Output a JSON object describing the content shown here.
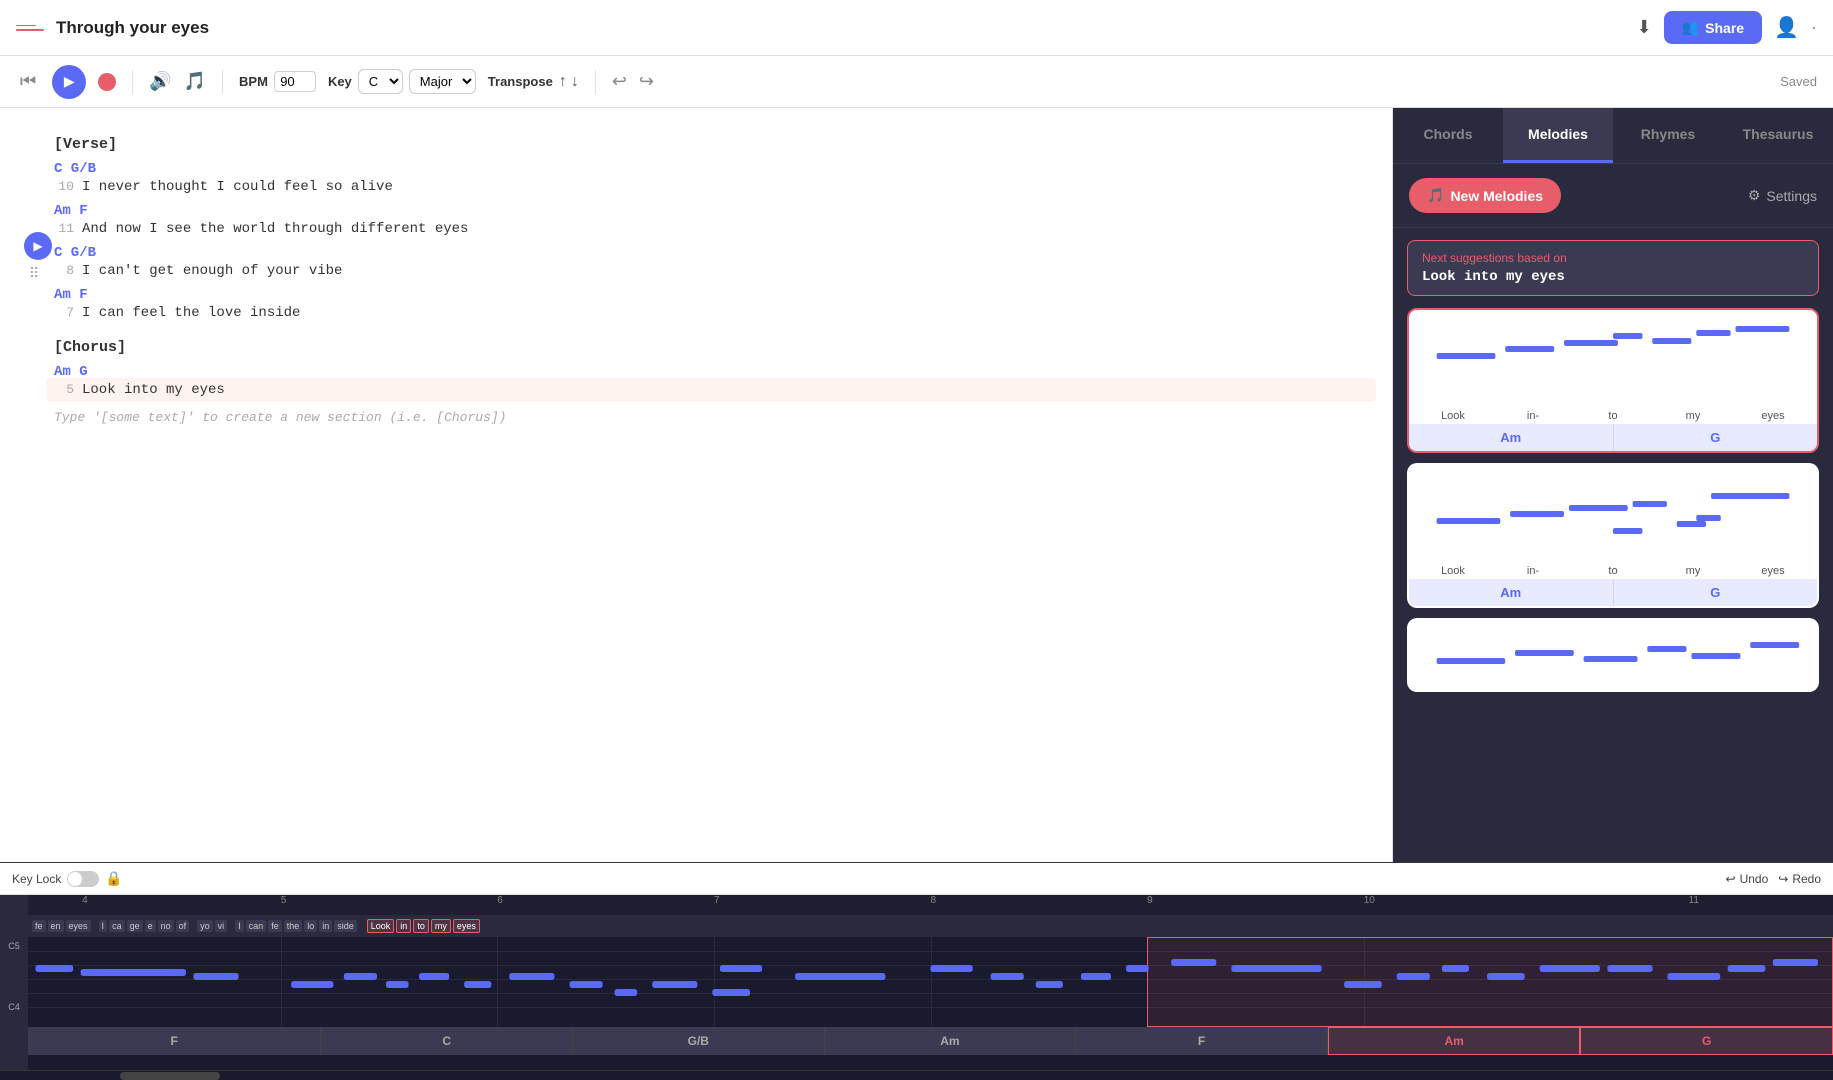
{
  "header": {
    "title": "Through your eyes",
    "share_label": "Share",
    "saved_label": "Saved"
  },
  "toolbar": {
    "bpm_label": "BPM",
    "bpm_value": "90",
    "key_label": "Key",
    "key_value": "C",
    "mode_value": "Major",
    "transpose_label": "Transpose"
  },
  "tabs": [
    {
      "id": "chords",
      "label": "Chords"
    },
    {
      "id": "melodies",
      "label": "Melodies",
      "active": true
    },
    {
      "id": "rhymes",
      "label": "Rhymes"
    },
    {
      "id": "thesaurus",
      "label": "Thesaurus"
    }
  ],
  "suggestions": {
    "new_melodies_label": "New Melodies",
    "settings_label": "Settings",
    "next_label": "Next suggestions based on",
    "next_text": "Look into my eyes",
    "cards": [
      {
        "words": [
          "Look",
          "in-",
          "to",
          "my",
          "eyes"
        ],
        "chords": [
          "Am",
          "G"
        ],
        "selected": true
      },
      {
        "words": [
          "Look",
          "in-",
          "to",
          "my",
          "eyes"
        ],
        "chords": [
          "Am",
          "G"
        ],
        "selected": false
      },
      {
        "words": [],
        "chords": [],
        "selected": false
      }
    ]
  },
  "editor": {
    "sections": [
      {
        "type": "section",
        "label": "[Verse]"
      },
      {
        "type": "lyric",
        "chords": "C G/B",
        "num": "10",
        "text": "I never thought I could feel so alive"
      },
      {
        "type": "lyric",
        "chords": "Am F",
        "num": "11",
        "text": "And now I see the world through different eyes"
      },
      {
        "type": "lyric",
        "chords": "C G/B",
        "num": "8",
        "text": "I can't get enough of your vibe"
      },
      {
        "type": "lyric",
        "chords": "Am F",
        "num": "7",
        "text": "I can feel the love inside"
      },
      {
        "type": "section",
        "label": "[Chorus]"
      },
      {
        "type": "lyric",
        "chords": "Am G",
        "num": "5",
        "text": "Look into my eyes",
        "highlight": true
      }
    ],
    "placeholder": "Type '[some text]' to create a new section (i.e. [Chorus])"
  },
  "bottom": {
    "key_lock_label": "Key Lock",
    "undo_label": "Undo",
    "redo_label": "Redo",
    "notes_c5": "C5",
    "notes_c4": "C4",
    "measures": [
      "4",
      "5",
      "6",
      "7",
      "8",
      "9",
      "10",
      "11"
    ],
    "lyric_chips": [
      "fe",
      "en",
      "eyes",
      "I",
      "ca",
      "ge",
      "e",
      "no",
      "of",
      "yo",
      "vi",
      "I",
      "can",
      "fe",
      "the",
      "lo",
      "in",
      "side",
      "Look",
      "in",
      "to",
      "my",
      "eyes"
    ],
    "chords": [
      {
        "label": "F",
        "color": "#3a3a52"
      },
      {
        "label": "C",
        "color": "#3a3a52"
      },
      {
        "label": "G/B",
        "color": "#3a3a52"
      },
      {
        "label": "Am",
        "color": "#3a3a52"
      },
      {
        "label": "F",
        "color": "#3a3a52"
      },
      {
        "label": "Am",
        "color": "#e85d6a22"
      },
      {
        "label": "G",
        "color": "#e85d6a22"
      }
    ]
  }
}
